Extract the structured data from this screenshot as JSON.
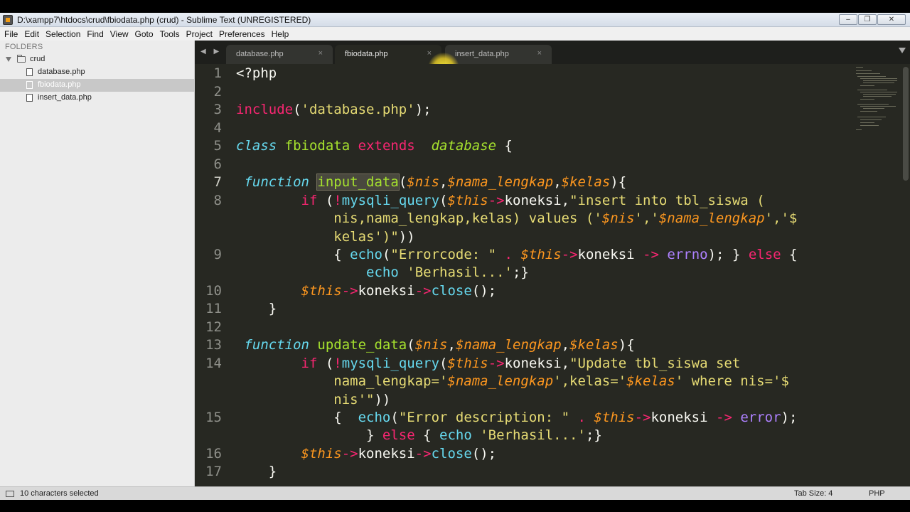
{
  "window": {
    "title": "D:\\xampp7\\htdocs\\crud\\fbiodata.php (crud) - Sublime Text (UNREGISTERED)",
    "minimize_glyph": "‒",
    "maximize_glyph": "❐",
    "close_glyph": "✕"
  },
  "menu": [
    "File",
    "Edit",
    "Selection",
    "Find",
    "View",
    "Goto",
    "Tools",
    "Project",
    "Preferences",
    "Help"
  ],
  "sidebar": {
    "header": "FOLDERS",
    "folder": "crud",
    "files": [
      "database.php",
      "fbiodata.php",
      "insert_data.php"
    ],
    "selected_file": "fbiodata.php"
  },
  "tabs": [
    {
      "label": "database.php",
      "close": "×"
    },
    {
      "label": "fbiodata.php",
      "close": "×"
    },
    {
      "label": "insert_data.php",
      "close": "×"
    }
  ],
  "tab_nav": "◀ ▶",
  "active_tab": "fbiodata.php",
  "editor": {
    "line_numbers": [
      "1",
      "2",
      "3",
      "4",
      "5",
      "6",
      "7",
      "8",
      "",
      "",
      "9",
      "",
      "10",
      "11",
      "12",
      "13",
      "14",
      "",
      "",
      "15",
      "",
      "16",
      "17"
    ],
    "current_line": "7"
  },
  "status": {
    "selection": "10 characters selected",
    "tab_size": "Tab Size: 4",
    "syntax": "PHP"
  }
}
